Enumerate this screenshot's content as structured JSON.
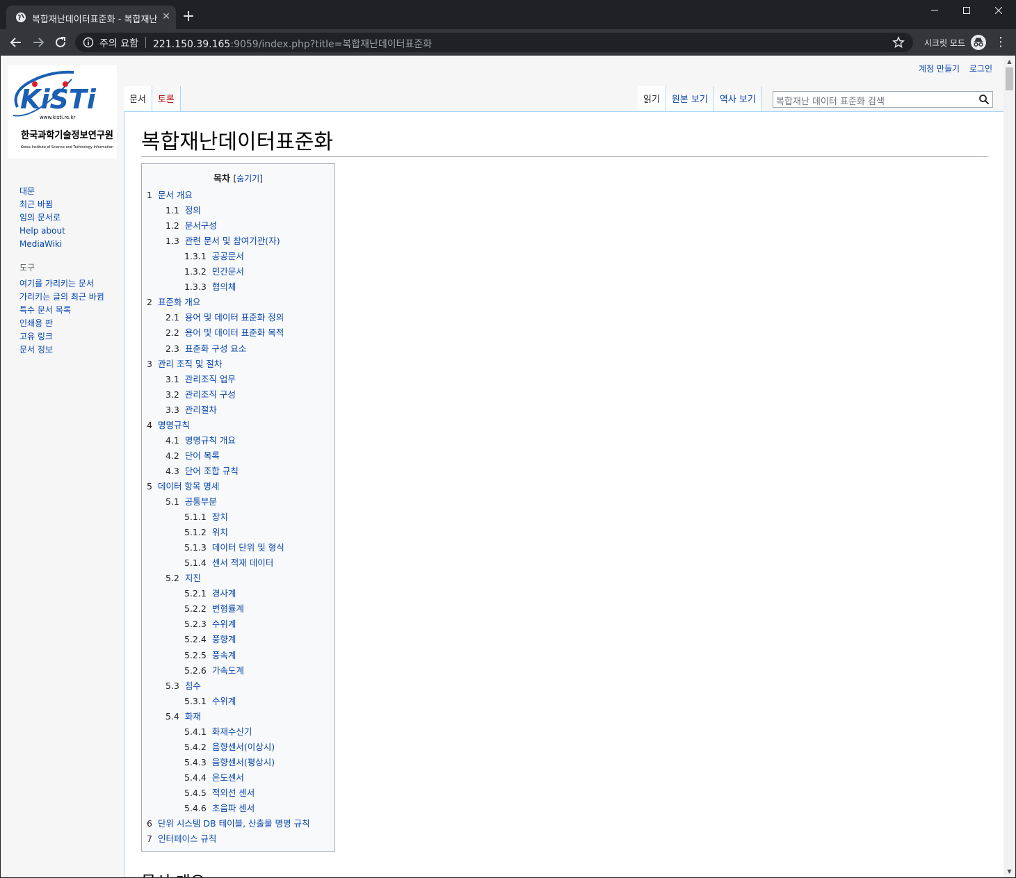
{
  "browser": {
    "tab_title": "복합재난데이터표준화 - 복합재난",
    "security_label": "주의 요함",
    "url_host": "221.150.39.165",
    "url_rest": ":9059/index.php?title=복합재난데이터표준화",
    "incognito_label": "시크릿 모드"
  },
  "personal": {
    "create_account": "계정 만들기",
    "login": "로그인"
  },
  "logo": {
    "brand": "KiSTi",
    "url": "www.kisti.re.kr",
    "name_ko": "한국과학기술정보연구원",
    "name_en": "Korea Institute of Science and Technology Information"
  },
  "sidebar": {
    "nav": [
      "대문",
      "최근 바뀜",
      "임의 문서로",
      "Help about MediaWiki"
    ],
    "tools_heading": "도구",
    "tools": [
      "여기를 가리키는 문서",
      "가리키는 글의 최근 바뀜",
      "특수 문서 목록",
      "인쇄용 판",
      "고유 링크",
      "문서 정보"
    ]
  },
  "tabs": {
    "page": "문서",
    "talk": "토론",
    "read": "읽기",
    "view_source": "원본 보기",
    "history": "역사 보기"
  },
  "search": {
    "placeholder": "복합재난 데이터 표준화 검색"
  },
  "page": {
    "title": "복합재난데이터표준화",
    "next_heading": "문서 개요"
  },
  "toc": {
    "title": "목차",
    "toggle": "숨기기",
    "entries": [
      {
        "num": "1",
        "text": "문서 개요",
        "level": 1
      },
      {
        "num": "1.1",
        "text": "정의",
        "level": 2
      },
      {
        "num": "1.2",
        "text": "문서구성",
        "level": 2
      },
      {
        "num": "1.3",
        "text": "관련 문서 및 참여기관(자)",
        "level": 2
      },
      {
        "num": "1.3.1",
        "text": "공공문서",
        "level": 3
      },
      {
        "num": "1.3.2",
        "text": "민간문서",
        "level": 3
      },
      {
        "num": "1.3.3",
        "text": "협의체",
        "level": 3
      },
      {
        "num": "2",
        "text": "표준화 개요",
        "level": 1
      },
      {
        "num": "2.1",
        "text": "용어 및 데이터 표준화 정의",
        "level": 2
      },
      {
        "num": "2.2",
        "text": "용어 및 데이터 표준화 목적",
        "level": 2
      },
      {
        "num": "2.3",
        "text": "표준화 구성 요소",
        "level": 2
      },
      {
        "num": "3",
        "text": "관리 조직 및 절차",
        "level": 1
      },
      {
        "num": "3.1",
        "text": "관리조직 업무",
        "level": 2
      },
      {
        "num": "3.2",
        "text": "관리조직 구성",
        "level": 2
      },
      {
        "num": "3.3",
        "text": "관리절차",
        "level": 2
      },
      {
        "num": "4",
        "text": "명명규칙",
        "level": 1
      },
      {
        "num": "4.1",
        "text": "명명규칙 개요",
        "level": 2
      },
      {
        "num": "4.2",
        "text": "단어 목록",
        "level": 2
      },
      {
        "num": "4.3",
        "text": "단어 조합 규칙",
        "level": 2
      },
      {
        "num": "5",
        "text": "데이터 항목 명세",
        "level": 1
      },
      {
        "num": "5.1",
        "text": "공통부분",
        "level": 2
      },
      {
        "num": "5.1.1",
        "text": "장치",
        "level": 3
      },
      {
        "num": "5.1.2",
        "text": "위치",
        "level": 3
      },
      {
        "num": "5.1.3",
        "text": "데이터 단위 및 형식",
        "level": 3
      },
      {
        "num": "5.1.4",
        "text": "센서 적재 데이터",
        "level": 3
      },
      {
        "num": "5.2",
        "text": "지진",
        "level": 2
      },
      {
        "num": "5.2.1",
        "text": "경사계",
        "level": 3
      },
      {
        "num": "5.2.2",
        "text": "변형률계",
        "level": 3
      },
      {
        "num": "5.2.3",
        "text": "수위계",
        "level": 3
      },
      {
        "num": "5.2.4",
        "text": "풍향계",
        "level": 3
      },
      {
        "num": "5.2.5",
        "text": "풍속계",
        "level": 3
      },
      {
        "num": "5.2.6",
        "text": "가속도계",
        "level": 3
      },
      {
        "num": "5.3",
        "text": "침수",
        "level": 2
      },
      {
        "num": "5.3.1",
        "text": "수위계",
        "level": 3
      },
      {
        "num": "5.4",
        "text": "화재",
        "level": 2
      },
      {
        "num": "5.4.1",
        "text": "화재수신기",
        "level": 3
      },
      {
        "num": "5.4.2",
        "text": "음향센서(이상시)",
        "level": 3
      },
      {
        "num": "5.4.3",
        "text": "음향센서(평상시)",
        "level": 3
      },
      {
        "num": "5.4.4",
        "text": "온도센서",
        "level": 3
      },
      {
        "num": "5.4.5",
        "text": "적외선 센서",
        "level": 3
      },
      {
        "num": "5.4.6",
        "text": "초음파 센서",
        "level": 3
      },
      {
        "num": "6",
        "text": "단위 시스템 DB 테이블, 산출물 명명 규칙",
        "level": 1
      },
      {
        "num": "7",
        "text": "인터페이스 규칙",
        "level": 1
      }
    ]
  }
}
